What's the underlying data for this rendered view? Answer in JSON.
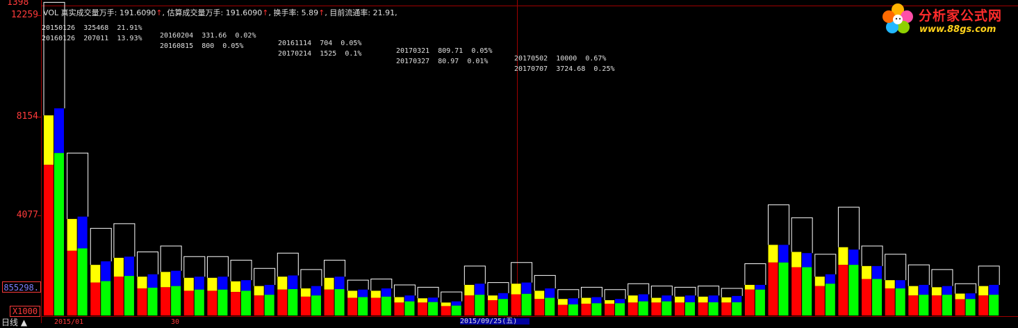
{
  "axis": {
    "top_label": "1398",
    "labels": [
      "12259",
      "8154",
      "4077"
    ],
    "label_values": [
      12259,
      8154,
      4077
    ],
    "highlight_value": "855298.",
    "multiplier": "X1000",
    "corner_label": "日线 ▲"
  },
  "indicator": {
    "name": "VOL",
    "real_label": "真实成交量万手: 191.6090",
    "est_label": "估算成交量万手: 191.6090",
    "turnover_label": "换手率: 5.89",
    "float_label": "目前流通率: 21.91,",
    "arrow": "↑"
  },
  "history": {
    "row1": [
      "20150126  325468  21.91%",
      "20160204  331.66  0.02%",
      "20161114  704  0.05%",
      "20170321  809.71  0.05%",
      "20170502  10000  0.67%"
    ],
    "row2": [
      "20160126  207011  13.93%",
      "20160815  800  0.05%",
      "20170214  1525  0.1%",
      "20170327  80.97  0.01%",
      "20170707  3724.68  0.25%"
    ]
  },
  "bottom": {
    "left_date": "2015/01",
    "mid_date": "30",
    "cursor_date": "2015/09/25(五)"
  },
  "logo": {
    "title": "分析家公式网",
    "url": "www.88gs.com"
  },
  "colors": {
    "red": "#ff0000",
    "yellow": "#ffff00",
    "green": "#00ff00",
    "blue": "#0000ff",
    "outline": "#ffffff",
    "axis": "#ff3b3b"
  },
  "chart_data": {
    "type": "bar",
    "ylim": [
      0,
      13400
    ],
    "series": [
      {
        "values": [
          [
            8500,
            6400,
            8800,
            6900,
            13300
          ],
          [
            4100,
            2750,
            4200,
            2850,
            6900
          ],
          [
            2150,
            1400,
            2300,
            1460,
            3700
          ],
          [
            2450,
            1650,
            2500,
            1680,
            3900
          ],
          [
            1650,
            1150,
            1750,
            1180,
            2700
          ],
          [
            1850,
            1200,
            1900,
            1250,
            2950
          ],
          [
            1600,
            1050,
            1650,
            1100,
            2500
          ],
          [
            1600,
            1050,
            1650,
            1100,
            2500
          ],
          [
            1450,
            1000,
            1500,
            1050,
            2350
          ],
          [
            1250,
            850,
            1300,
            880,
            2000
          ],
          [
            1650,
            1100,
            1700,
            1120,
            2650
          ],
          [
            1150,
            800,
            1250,
            850,
            1950
          ],
          [
            1600,
            1100,
            1650,
            1120,
            2350
          ],
          [
            1050,
            750,
            1100,
            780,
            1500
          ],
          [
            1050,
            750,
            1150,
            800,
            1550
          ],
          [
            780,
            550,
            850,
            600,
            1300
          ],
          [
            730,
            550,
            760,
            570,
            1200
          ],
          [
            550,
            400,
            600,
            420,
            1000
          ],
          [
            1300,
            850,
            1350,
            880,
            2100
          ],
          [
            850,
            650,
            950,
            700,
            1400
          ],
          [
            1350,
            900,
            1400,
            920,
            2250
          ],
          [
            1050,
            700,
            1150,
            750,
            1700
          ],
          [
            700,
            450,
            730,
            470,
            1100
          ],
          [
            750,
            500,
            780,
            520,
            1200
          ],
          [
            650,
            500,
            700,
            520,
            1100
          ],
          [
            850,
            550,
            900,
            600,
            1350
          ],
          [
            750,
            550,
            850,
            600,
            1250
          ],
          [
            800,
            550,
            850,
            560,
            1200
          ],
          [
            800,
            550,
            850,
            560,
            1250
          ],
          [
            770,
            550,
            830,
            560,
            1150
          ],
          [
            1300,
            1100,
            1300,
            1100,
            2200
          ],
          [
            3000,
            2250,
            3000,
            2250,
            4700
          ],
          [
            2700,
            2050,
            2650,
            2050,
            4150
          ],
          [
            1650,
            1250,
            1750,
            1350,
            2600
          ],
          [
            2900,
            2150,
            2800,
            2150,
            4600
          ],
          [
            2100,
            1550,
            2100,
            1550,
            2950
          ],
          [
            1500,
            1150,
            1500,
            1150,
            2600
          ],
          [
            1250,
            850,
            1300,
            880,
            2150
          ],
          [
            1200,
            850,
            1250,
            880,
            1950
          ],
          [
            930,
            690,
            940,
            700,
            1350
          ],
          [
            1250,
            850,
            1300,
            880,
            2100
          ]
        ]
      }
    ],
    "encoding": "each group = [yellow_top, red_top, blue_top, green_top, outline_top]"
  }
}
